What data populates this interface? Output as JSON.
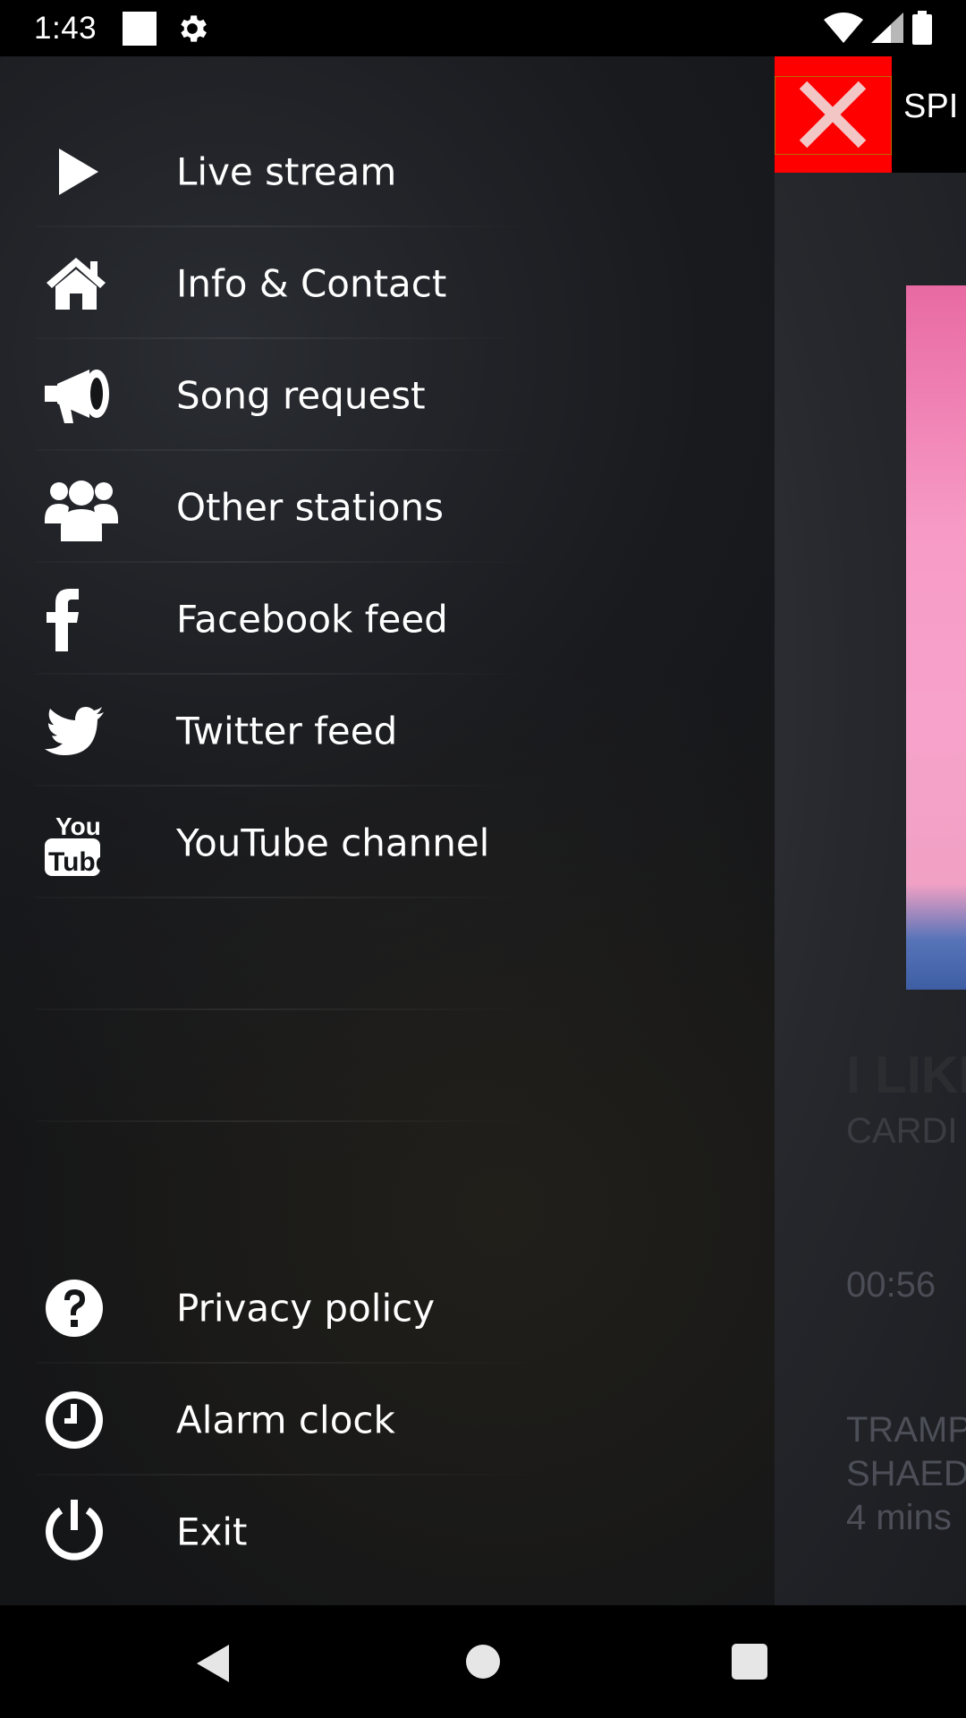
{
  "status_bar": {
    "time": "1:43"
  },
  "background_app": {
    "title": "SPI",
    "song_title": "I LIKE",
    "song_artist": "CARDI",
    "elapsed": "00:56",
    "next_line_1": "TRAMP",
    "next_line_2": "SHAED",
    "next_line_3": "4 mins"
  },
  "drawer": {
    "items": [
      {
        "label": "Live stream",
        "icon": "play-icon"
      },
      {
        "label": "Info & Contact",
        "icon": "home-icon"
      },
      {
        "label": "Song request",
        "icon": "megaphone-icon"
      },
      {
        "label": "Other stations",
        "icon": "users-icon"
      },
      {
        "label": "Facebook feed",
        "icon": "facebook-icon"
      },
      {
        "label": "Twitter feed",
        "icon": "twitter-icon"
      },
      {
        "label": "YouTube channel",
        "icon": "youtube-icon"
      }
    ],
    "bottom_items": [
      {
        "label": "Privacy policy",
        "icon": "question-circle-icon"
      },
      {
        "label": "Alarm clock",
        "icon": "clock-icon"
      },
      {
        "label": "Exit",
        "icon": "power-icon"
      }
    ],
    "youtube_icon_text_top": "You",
    "youtube_icon_text_bottom": "Tube"
  },
  "colors": {
    "close_red": "#ff0000",
    "drawer_bg": "#141517",
    "text": "#ffffff"
  }
}
